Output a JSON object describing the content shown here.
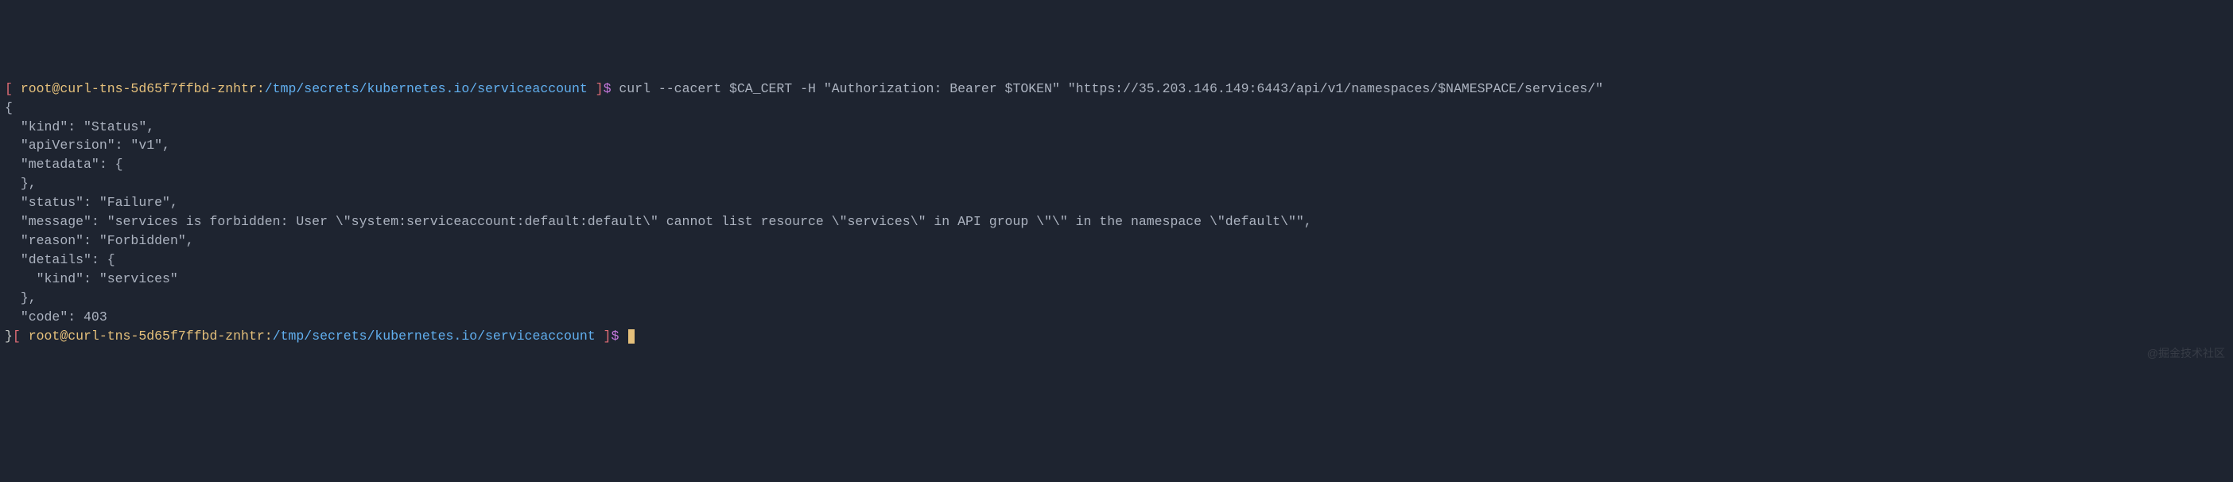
{
  "prompt1": {
    "open_bracket": "[ ",
    "user_host": "root@curl-tns-5d65f7ffbd-znhtr",
    "colon": ":",
    "path": "/tmp/secrets/kubernetes.io/serviceaccount",
    "close_bracket": " ]",
    "dollar": "$ ",
    "command": "curl --cacert $CA_CERT -H \"Authorization: Bearer $TOKEN\" \"https://35.203.146.149:6443/api/v1/namespaces/$NAMESPACE/services/\""
  },
  "output_lines": [
    "{",
    "  \"kind\": \"Status\",",
    "  \"apiVersion\": \"v1\",",
    "  \"metadata\": {",
    "",
    "  },",
    "  \"status\": \"Failure\",",
    "  \"message\": \"services is forbidden: User \\\"system:serviceaccount:default:default\\\" cannot list resource \\\"services\\\" in API group \\\"\\\" in the namespace \\\"default\\\"\",",
    "  \"reason\": \"Forbidden\",",
    "  \"details\": {",
    "    \"kind\": \"services\"",
    "  },",
    "  \"code\": 403",
    "}"
  ],
  "prompt2": {
    "open_bracket": "[ ",
    "user_host": "root@curl-tns-5d65f7ffbd-znhtr",
    "colon": ":",
    "path": "/tmp/secrets/kubernetes.io/serviceaccount",
    "close_bracket": " ]",
    "dollar": "$ "
  },
  "watermark": "@掘金技术社区"
}
